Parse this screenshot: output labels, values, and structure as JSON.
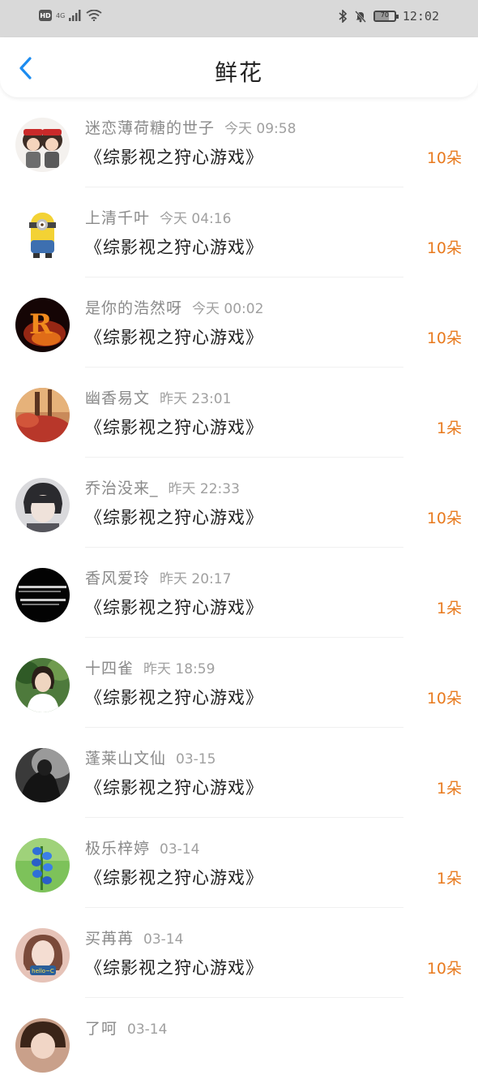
{
  "status_bar": {
    "hd": "HD",
    "network": "4G",
    "battery": "70",
    "battery_level": 0.7,
    "time": "12:02"
  },
  "header": {
    "title": "鲜花"
  },
  "colors": {
    "accent_blue": "#1c8cf0",
    "count_orange": "#e87a1e"
  },
  "items": [
    {
      "name": "迷恋薄荷糖的世子",
      "time": "今天 09:58",
      "work": "《综影视之狩心游戏》",
      "count": "10朵"
    },
    {
      "name": "上清千叶",
      "time": "今天 04:16",
      "work": "《综影视之狩心游戏》",
      "count": "10朵"
    },
    {
      "name": "是你的浩然呀",
      "time": "今天 00:02",
      "work": "《综影视之狩心游戏》",
      "count": "10朵"
    },
    {
      "name": "幽香易文",
      "time": "昨天 23:01",
      "work": "《综影视之狩心游戏》",
      "count": "1朵"
    },
    {
      "name": "乔治没来_",
      "time": "昨天 22:33",
      "work": "《综影视之狩心游戏》",
      "count": "10朵"
    },
    {
      "name": "香风爱玲",
      "time": "昨天 20:17",
      "work": "《综影视之狩心游戏》",
      "count": "1朵"
    },
    {
      "name": "十四雀",
      "time": "昨天 18:59",
      "work": "《综影视之狩心游戏》",
      "count": "10朵"
    },
    {
      "name": "蓬莱山文仙",
      "time": "03-15",
      "work": "《综影视之狩心游戏》",
      "count": "1朵"
    },
    {
      "name": "极乐梓婷",
      "time": "03-14",
      "work": "《综影视之狩心游戏》",
      "count": "1朵"
    },
    {
      "name": "买苒苒",
      "time": "03-14",
      "work": "《综影视之狩心游戏》",
      "count": "10朵"
    },
    {
      "name": "了呵",
      "time": "03-14",
      "work": "",
      "count": ""
    }
  ],
  "avatar_texts": {
    "r_letter": "R",
    "hello_sticker": "hello~C"
  }
}
